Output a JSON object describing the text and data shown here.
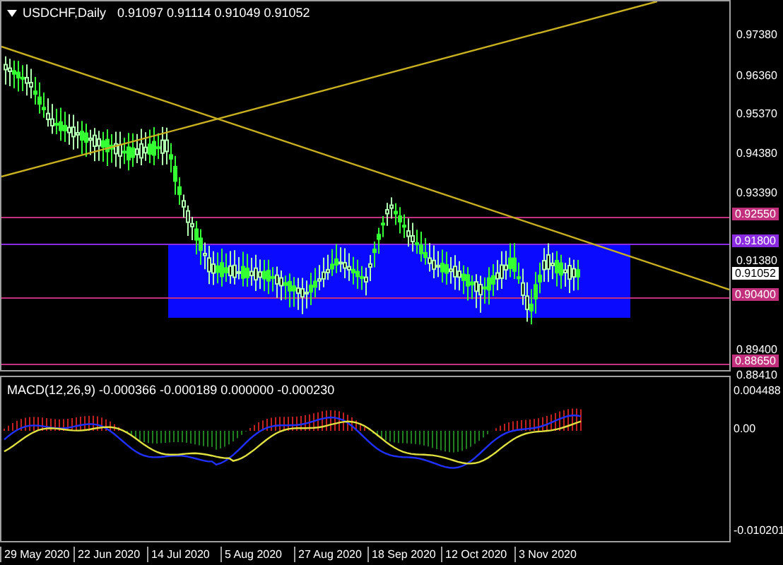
{
  "chart": {
    "symbol": "USDCHF,Daily",
    "ohlc": [
      "0.91097",
      "0.91114",
      "0.91049",
      "0.91052"
    ],
    "price_axis": [
      "0.97380",
      "0.96360",
      "0.95370",
      "0.94380",
      "0.93390",
      "0.91380",
      "0.89400",
      "0.88410"
    ],
    "levels": [
      {
        "label": "0.92550",
        "color": "#c2307d"
      },
      {
        "label": "0.91800",
        "color": "#8a2be2"
      },
      {
        "label": "0.90400",
        "color": "#c2307d"
      },
      {
        "label": "0.88650",
        "color": "#c2307d"
      }
    ],
    "current_price": "0.91052"
  },
  "macd": {
    "label": "MACD(12,26,9) -0.000366 -0.000189 0.000000 -0.000230",
    "axis": [
      "0.004488",
      "0.00",
      "-0.010201"
    ]
  },
  "date_axis": [
    "29 May 2020",
    "22 Jun 2020",
    "14 Jul 2020",
    "5 Aug 2020",
    "27 Aug 2020",
    "18 Sep 2020",
    "12 Oct 2020",
    "3 Nov 2020"
  ]
}
